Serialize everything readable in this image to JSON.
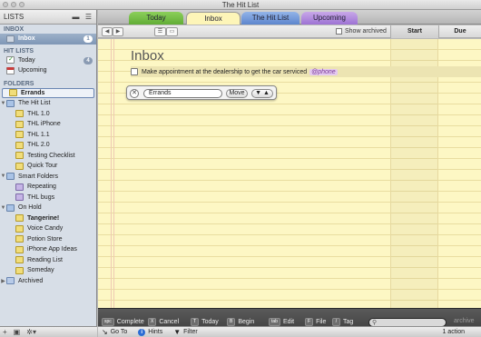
{
  "window": {
    "title": "The Hit List"
  },
  "sidebar": {
    "header": "LISTS",
    "sections": {
      "inbox": "INBOX",
      "hitlists": "HIT LISTS",
      "folders": "FOLDERS"
    },
    "inbox": {
      "label": "Inbox",
      "count": "1"
    },
    "today": {
      "label": "Today",
      "count": "4"
    },
    "upcoming": {
      "label": "Upcoming"
    },
    "folders": [
      {
        "label": "Errands"
      },
      {
        "label": "The Hit List"
      },
      {
        "label": "THL 1.0"
      },
      {
        "label": "THL iPhone"
      },
      {
        "label": "THL 1.1"
      },
      {
        "label": "THL 2.0"
      },
      {
        "label": "Testing Checklist"
      },
      {
        "label": "Quick Tour"
      },
      {
        "label": "Smart Folders"
      },
      {
        "label": "Repeating"
      },
      {
        "label": "THL bugs"
      },
      {
        "label": "On Hold"
      },
      {
        "label": "Tangerine!"
      },
      {
        "label": "Voice Candy"
      },
      {
        "label": "Potion Store"
      },
      {
        "label": "iPhone App Ideas"
      },
      {
        "label": "Reading List"
      },
      {
        "label": "Someday"
      },
      {
        "label": "Archived"
      }
    ]
  },
  "tabs": {
    "today": "Today",
    "inbox": "Inbox",
    "hitlist": "The Hit List",
    "upcoming": "Upcoming"
  },
  "toolbar": {
    "show_archived": "Show archived",
    "col_start": "Start",
    "col_due": "Due"
  },
  "content": {
    "page_title": "Inbox",
    "task": {
      "text": "Make appointment at the dealership to get the car serviced",
      "tag": "@phone"
    },
    "move": {
      "field_value": "Errands",
      "move_label": "Move"
    }
  },
  "actions": {
    "complete": {
      "key": "spc",
      "label": "Complete"
    },
    "cancel": {
      "key": "X",
      "label": "Cancel"
    },
    "today": {
      "key": "T",
      "label": "Today"
    },
    "begin": {
      "key": "B",
      "label": "Begin"
    },
    "edit": {
      "key": "tab",
      "label": "Edit"
    },
    "file": {
      "key": "F",
      "label": "File"
    },
    "tag": {
      "key": "/",
      "label": "Tag"
    },
    "archive": "archive"
  },
  "status": {
    "goto": "Go To",
    "hints": "Hints",
    "filter": "Filter",
    "actions": "1 action"
  }
}
